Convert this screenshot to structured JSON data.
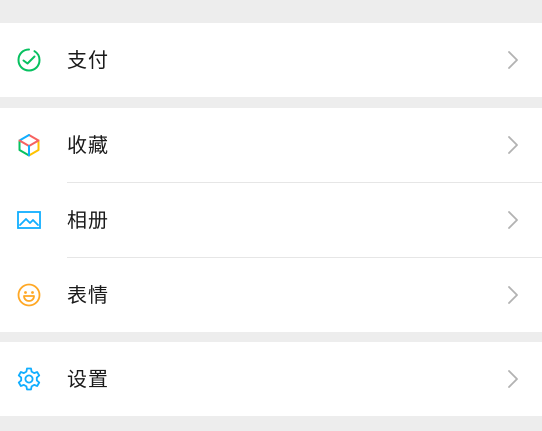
{
  "menu": {
    "pay": {
      "label": "支付",
      "icon": "wallet-check-icon",
      "color": "#07c160"
    },
    "favorites": {
      "label": "收藏",
      "icon": "cube-icon",
      "colors": [
        "#f76260",
        "#ffc300",
        "#10aeff",
        "#07c160"
      ]
    },
    "album": {
      "label": "相册",
      "icon": "image-icon",
      "color": "#10aeff"
    },
    "stickers": {
      "label": "表情",
      "icon": "smile-icon",
      "color": "#ffa825"
    },
    "settings": {
      "label": "设置",
      "icon": "gear-icon",
      "color": "#10aeff"
    }
  },
  "chevron_icon": "chevron-right-icon",
  "colors": {
    "background": "#ededed",
    "row_background": "#ffffff",
    "text": "#1a1a1a",
    "chevron": "#b2b2b2",
    "divider": "#e6e6e6"
  }
}
